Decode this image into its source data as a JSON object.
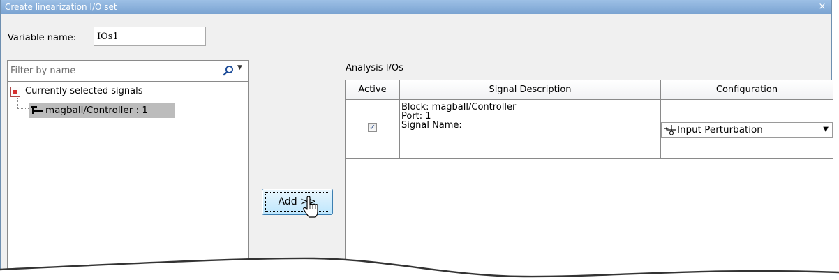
{
  "window": {
    "title": "Create linearization I/O set",
    "close_glyph": "×"
  },
  "variable": {
    "label": "Variable name:",
    "value": "IOs1"
  },
  "filter": {
    "placeholder": "Filter by name",
    "search_icon": "search-icon"
  },
  "tree": {
    "root_label": "Currently selected signals",
    "child_label": "magball/Controller : 1"
  },
  "add_button": {
    "label": "Add >>"
  },
  "analysis": {
    "label": "Analysis I/Os",
    "columns": [
      "Active",
      "Signal Description",
      "Configuration"
    ],
    "rows": [
      {
        "active": true,
        "description": [
          "Block: magball/Controller",
          "Port: 1",
          "Signal Name:"
        ],
        "configuration": "Input Perturbation"
      }
    ]
  },
  "colors": {
    "titlebar": "#7aa3d1",
    "selection": "#bcbcbc",
    "button_border": "#3c7fb1"
  }
}
